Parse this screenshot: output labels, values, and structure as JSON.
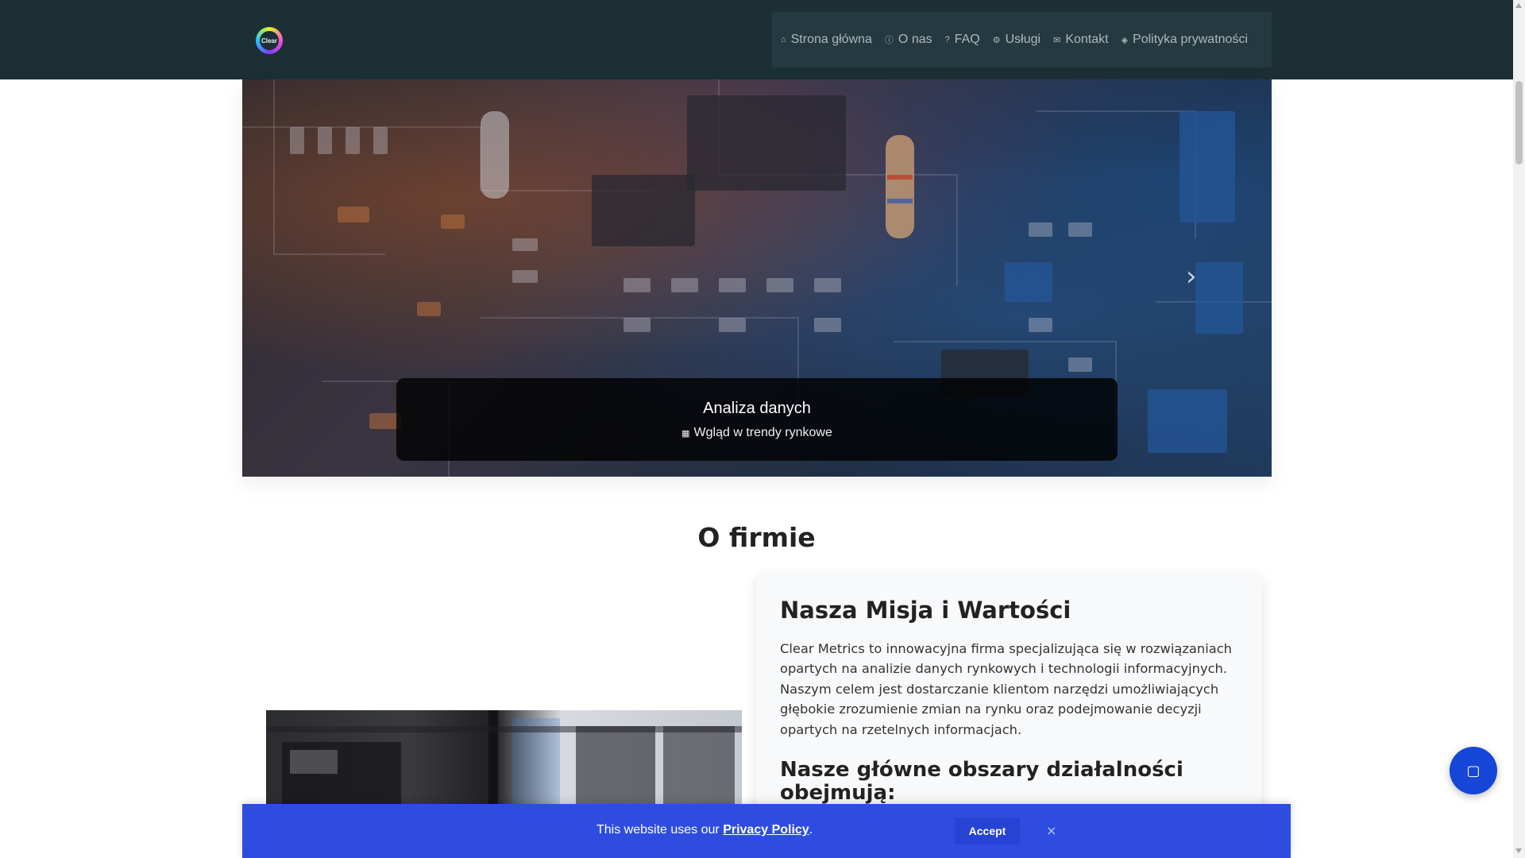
{
  "header": {
    "logo_text": "Clear",
    "nav": [
      {
        "label": "Strona główna",
        "icon": "home-icon"
      },
      {
        "label": "O nas",
        "icon": "info-icon"
      },
      {
        "label": "FAQ",
        "icon": "question-icon"
      },
      {
        "label": "Usługi",
        "icon": "services-icon"
      },
      {
        "label": "Kontakt",
        "icon": "envelope-icon"
      },
      {
        "label": "Polityka prywatności",
        "icon": "shield-icon"
      }
    ]
  },
  "hero": {
    "title": "Analiza danych",
    "subtitle": "Wgląd w trendy rynkowe",
    "subtitle_icon": "chart-icon"
  },
  "section": {
    "title": "O firmie"
  },
  "card": {
    "heading": "Nasza Misja i Wartości",
    "paragraph": "Clear Metrics to innowacyjna firma specjalizująca się w rozwiązaniach opartych na analizie danych rynkowych i technologii informacyjnych. Naszym celem jest dostarczanie klientom narzędzi umożliwiających głębokie zrozumienie zmian na rynku oraz podejmowanie decyzji opartych na rzetelnych informacjach.",
    "subheading": "Nasze główne obszary działalności obejmują:"
  },
  "cookie": {
    "text": "This website uses our ",
    "link": "Privacy Policy",
    "period": ".",
    "accept_label": "Accept",
    "close_symbol": "×"
  },
  "colors": {
    "header_bg": "#1b2f35",
    "nav_bg": "#243a40",
    "cookie_bg": "#2e4de0",
    "chat_button": "#1546d8"
  }
}
